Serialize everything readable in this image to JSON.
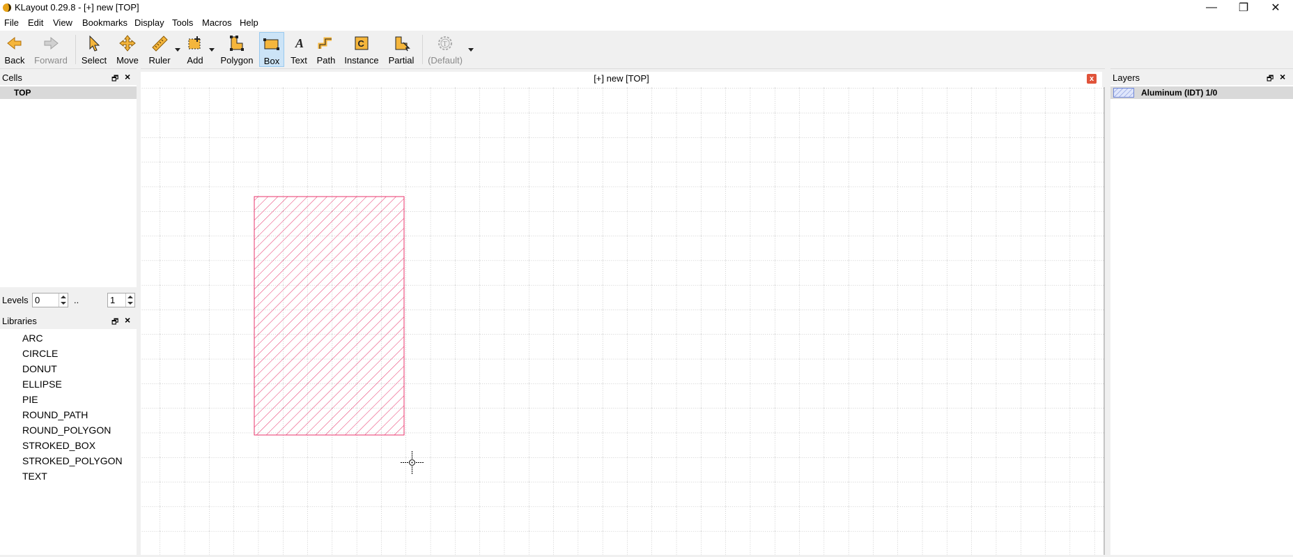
{
  "window": {
    "title": "KLayout 0.29.8 - [+] new [TOP]",
    "minimize_glyph": "—",
    "maximize_glyph": "❐",
    "close_glyph": "✕"
  },
  "menu": [
    "File",
    "Edit",
    "View",
    "Bookmarks",
    "Display",
    "Tools",
    "Macros",
    "Help"
  ],
  "toolbar": {
    "back": "Back",
    "forward": "Forward",
    "select": "Select",
    "move": "Move",
    "ruler": "Ruler",
    "add": "Add",
    "polygon": "Polygon",
    "box": "Box",
    "text": "Text",
    "path": "Path",
    "instance": "Instance",
    "partial": "Partial",
    "default_style": "(Default)",
    "active_tool": "Box"
  },
  "cells_panel": {
    "title": "Cells",
    "float_glyph": "🗗",
    "close_glyph": "×",
    "items": [
      "TOP"
    ]
  },
  "levels": {
    "label": "Levels",
    "from": "0",
    "separator": "..",
    "to": "1"
  },
  "libraries_panel": {
    "title": "Libraries",
    "float_glyph": "🗗",
    "close_glyph": "×",
    "items": [
      "ARC",
      "CIRCLE",
      "DONUT",
      "ELLIPSE",
      "PIE",
      "ROUND_PATH",
      "ROUND_POLYGON",
      "STROKED_BOX",
      "STROKED_POLYGON",
      "TEXT"
    ]
  },
  "canvas": {
    "title": "[+] new [TOP]",
    "close_glyph": "x"
  },
  "layers_panel": {
    "title": "Layers",
    "float_glyph": "🗗",
    "close_glyph": "×",
    "items": [
      {
        "name": "Aluminum (IDT) 1/0",
        "color": "#6f86d6"
      }
    ]
  },
  "colors": {
    "shape_stroke": "#e8336b",
    "grid": "#9a9a9a",
    "selection_accent": "#cce4f7"
  }
}
